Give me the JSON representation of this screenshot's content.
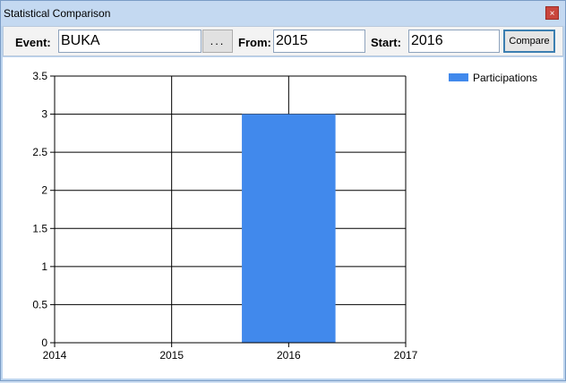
{
  "window": {
    "title": "Statistical Comparison",
    "close_glyph": "×"
  },
  "toolbar": {
    "event_label": "Event:",
    "event_value": "BUKA",
    "browse_label": "...",
    "from_label": "From:",
    "from_value": "2015",
    "start_label": "Start:",
    "start_value": "2016",
    "compare_label": "Compare"
  },
  "chart_data": {
    "type": "bar",
    "title": "",
    "xlabel": "",
    "ylabel": "",
    "xlim": [
      2014,
      2017
    ],
    "x_ticks": [
      "2014",
      "2015",
      "2016",
      "2017"
    ],
    "ylim": [
      0,
      3.5
    ],
    "y_ticks": [
      "0",
      "0.5",
      "1",
      "1.5",
      "2",
      "2.5",
      "3",
      "3.5"
    ],
    "grid": true,
    "legend_placement": "top-right",
    "series": [
      {
        "name": "Participations",
        "color": "#4189ec",
        "x": [
          2016
        ],
        "values": [
          3
        ]
      }
    ]
  }
}
